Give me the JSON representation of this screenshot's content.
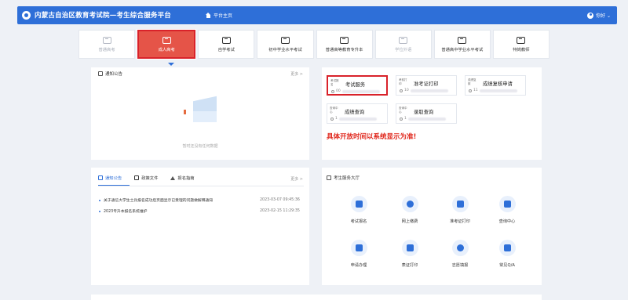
{
  "header": {
    "title": "内蒙古自治区教育考试院—考生综合服务平台",
    "home_label": "平台主页",
    "user_label": "你好 ⌄"
  },
  "tabs": [
    {
      "label": "普通高考",
      "disabled": true
    },
    {
      "label": "成人高考",
      "active": true
    },
    {
      "label": "自学考试"
    },
    {
      "label": "初中学业水平考试"
    },
    {
      "label": "普通高等教育专升本"
    },
    {
      "label": "学位外语",
      "disabled": true
    },
    {
      "label": "普通高中学业水平考试"
    },
    {
      "label": "特岗教师"
    }
  ],
  "notice_top": {
    "title": "通知公告",
    "more": "更多 >",
    "empty_text": "暂时还没有任何数据"
  },
  "services": [
    {
      "badge": "考试报名",
      "name": "考试服务",
      "time": "00"
    },
    {
      "badge": "考前打印",
      "name": "准考证打印",
      "time": "10"
    },
    {
      "badge": "成绩复核",
      "name": "成绩复核申请",
      "time": "11"
    },
    {
      "badge": "查询中心",
      "name": "成绩查询",
      "time": "1"
    },
    {
      "badge": "查询中心",
      "name": "录取查询",
      "time": "1"
    }
  ],
  "note": "具体开放时间以系统显示为准!",
  "notice_bottom": {
    "tabs": [
      "通知公告",
      "政策文件",
      "报名指南"
    ],
    "more": "更多 >",
    "rows": [
      {
        "title": "关于通信大学生士兵报名成功后页面显示已受理的问题做解释通知",
        "date": "2023-03-07 09:45:36"
      },
      {
        "title": "2023专升本报名系统维护",
        "date": "2023-02-15 11:29:35"
      }
    ]
  },
  "hall": {
    "title": "考生服务大厅",
    "items": [
      {
        "label": "考试报名",
        "icon": "graduation-cap-icon"
      },
      {
        "label": "网上缴费",
        "icon": "payment-icon"
      },
      {
        "label": "准考证打印",
        "icon": "printer-icon"
      },
      {
        "label": "查询中心",
        "icon": "document-icon"
      },
      {
        "label": "申请办理",
        "icon": "edit-icon"
      },
      {
        "label": "表证打印",
        "icon": "print-form-icon"
      },
      {
        "label": "志愿填报",
        "icon": "clover-icon"
      },
      {
        "label": "常见Q/A",
        "icon": "chat-icon"
      }
    ]
  },
  "colors": {
    "brand": "#2e6fd8",
    "highlight": "#d9222a",
    "active_tab": "#e55448",
    "note": "#e0261b"
  }
}
